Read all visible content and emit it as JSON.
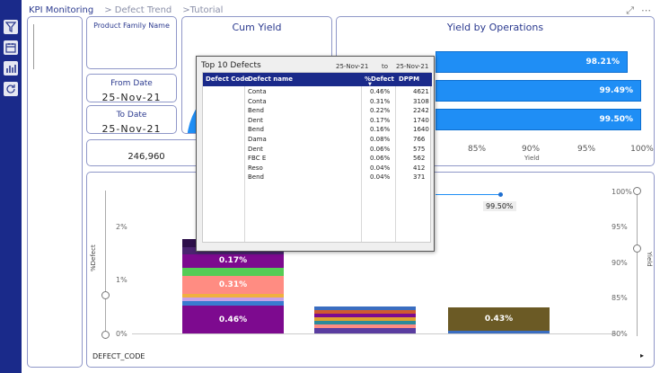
{
  "breadcrumb": [
    "KPI Monitoring",
    "> Defect Trend",
    ">Tutorial"
  ],
  "top_icons": [
    "expand-icon",
    "more-options-icon"
  ],
  "nav_icons": [
    "filter-icon",
    "calendar-icon",
    "bar-chart-icon",
    "refresh-icon"
  ],
  "filters": {
    "product_family_label": "Product Family Name",
    "from_date_label": "From Date",
    "from_date_value": "25-Nov-21",
    "to_date_label": "To Date",
    "to_date_value": "25-Nov-21",
    "total_value": "246,960"
  },
  "cum_yield": {
    "title": "Cum Yield"
  },
  "yield_by_operations": {
    "title": "Yield by Operations",
    "bars": [
      {
        "value_label": "98.21%"
      },
      {
        "value_label": "99.49%"
      },
      {
        "value_label": "99.50%"
      }
    ],
    "x_ticks": [
      "85%",
      "90%",
      "95%",
      "100%"
    ],
    "x_label": "Yield"
  },
  "main_chart": {
    "y_left_label": "%Defect",
    "y_right_label": "Yield",
    "y_left_ticks": [
      "2%",
      "1%",
      "0%"
    ],
    "y_right_ticks": [
      "100%",
      "95%",
      "90%",
      "85%",
      "80%"
    ],
    "x_label": "DEFECT_CODE",
    "annotations": [
      "0.17%",
      "0.31%",
      "0.46%",
      "0.43%"
    ],
    "yield_point_label": "99.50%",
    "colors": {
      "dark_purple": "#2d0f4a",
      "purple": "#7d0a8f",
      "green": "#55cc55",
      "pink": "#ff8c82",
      "olive": "#6b5a25",
      "accent": "#1f8ef5"
    }
  },
  "top_defects": {
    "title": "Top 10 Defects",
    "date_from": "25-Nov-21",
    "to_label": "to",
    "date_to": "25-Nov-21",
    "headers": [
      "Defect Code",
      "Defect name",
      "%Defect",
      "DPPM"
    ],
    "rows": [
      {
        "name": "Conta",
        "pct": "0.46%",
        "dppm": "4621"
      },
      {
        "name": "Conta",
        "pct": "0.31%",
        "dppm": "3108"
      },
      {
        "name": "Bend",
        "pct": "0.22%",
        "dppm": "2242"
      },
      {
        "name": "Dent",
        "pct": "0.17%",
        "dppm": "1740"
      },
      {
        "name": "Bend",
        "pct": "0.16%",
        "dppm": "1640"
      },
      {
        "name": "Dama",
        "pct": "0.08%",
        "dppm": "766"
      },
      {
        "name": "Dent",
        "pct": "0.06%",
        "dppm": "575"
      },
      {
        "name": "FBC E",
        "pct": "0.06%",
        "dppm": "562"
      },
      {
        "name": "Reso",
        "pct": "0.04%",
        "dppm": "412"
      },
      {
        "name": "Bend",
        "pct": "0.04%",
        "dppm": "371"
      }
    ]
  }
}
